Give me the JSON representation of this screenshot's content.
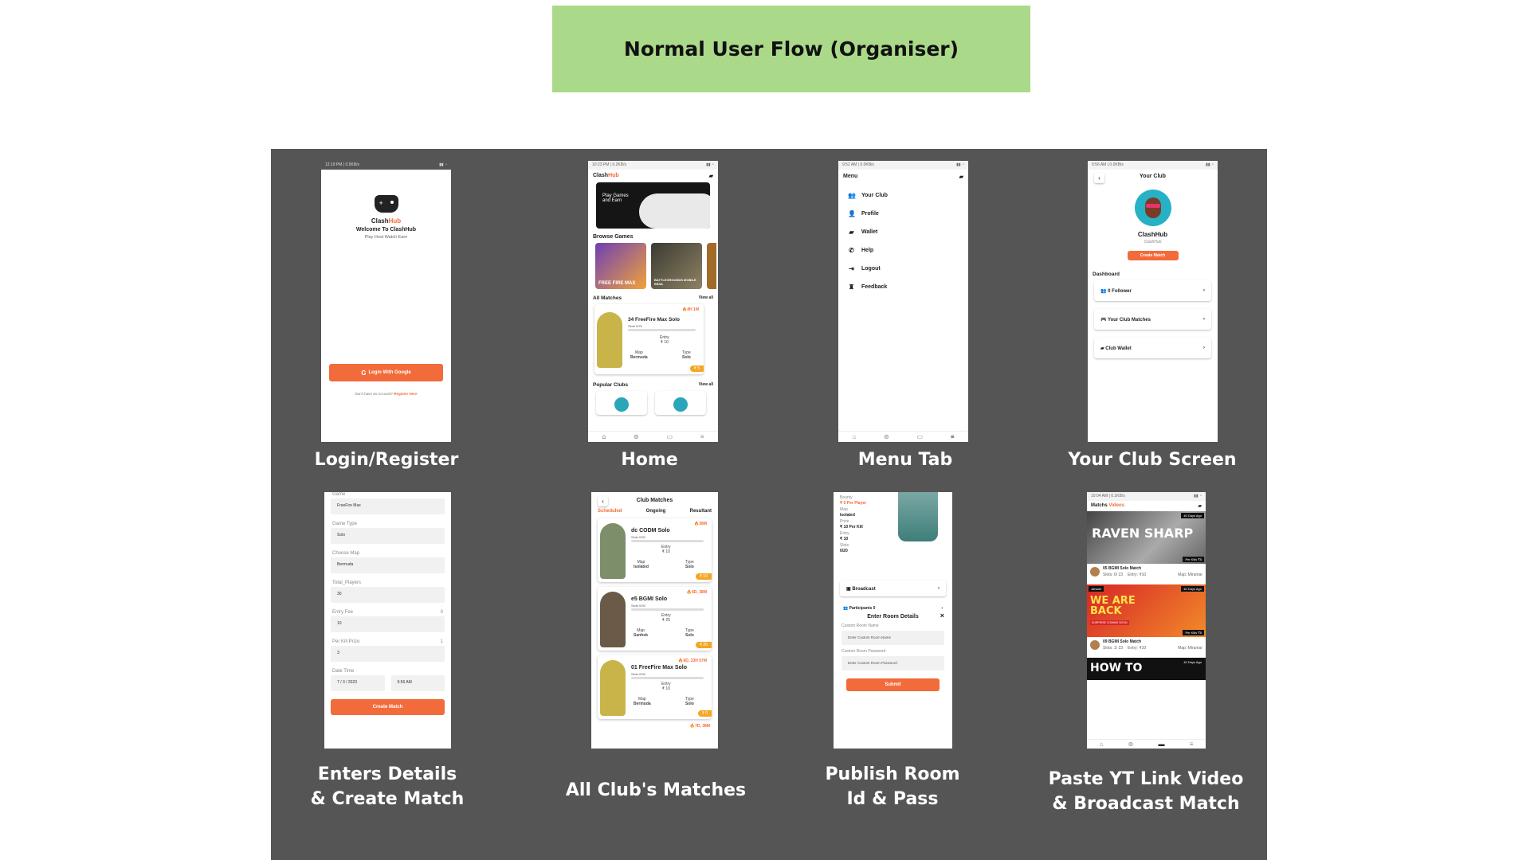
{
  "header": {
    "title": "Normal User Flow (Organiser)"
  },
  "screens": {
    "login": {
      "caption": "Login/Register",
      "status": "12:19 PM | 0.5KB/s",
      "brand_a": "Clash",
      "brand_b": "Hub",
      "welcome": "Welcome To ClashHub",
      "tagline": "Play Host Watch Earn",
      "google_btn": "Login With Google",
      "no_account": "Don't have an Account?",
      "register": "Register Here"
    },
    "home": {
      "caption": "Home",
      "status": "10:23 PM | 0.2KB/s",
      "brand_a": "Clash",
      "brand_b": "Hub",
      "banner": "Play Games and Earn",
      "browse": "Browse Games",
      "game1": "FREE FIRE MAX",
      "game2": "BATTLEGROUNDS MOBILE INDIA",
      "all_matches": "All Matches",
      "view_all": "View all",
      "hot": "4H 1M",
      "match_title": "34 FreeFire Max Solo",
      "slots": "Slots 0/20",
      "entry_lbl": "Entry",
      "entry": "₹ 10",
      "map_lbl": "Map",
      "map": "Bermuda",
      "type_lbl": "Type",
      "type": "Solo",
      "prize": "₹ 5",
      "popular": "Popular Clubs",
      "view_all2": "View all"
    },
    "menu": {
      "caption": "Menu Tab",
      "status": "9:52 AM | 0.0KB/s",
      "title": "Menu",
      "items": [
        {
          "label": "Your Club",
          "icon": "👥"
        },
        {
          "label": "Profile",
          "icon": "👤"
        },
        {
          "label": "Wallet",
          "icon": "▰"
        },
        {
          "label": "Help",
          "icon": "✆"
        },
        {
          "label": "Logout",
          "icon": "⇥"
        },
        {
          "label": "Feedback",
          "icon": "♜"
        }
      ]
    },
    "club": {
      "caption": "Your Club Screen",
      "status": "9:56 AM | 0.0KB/s",
      "title": "Your Club",
      "name": "ClashHub",
      "handle": "ClashHub",
      "create_btn": "Create Match",
      "dashboard": "Dashboard",
      "rows": [
        "0 Follower",
        "Your Club Matches",
        "Club Wallet"
      ]
    },
    "create": {
      "caption_1": "Enters Details",
      "caption_2": "& Create Match",
      "fields": [
        {
          "label": "Game",
          "value": "FreeFire Max"
        },
        {
          "label": "Game Type",
          "value": "Solo"
        },
        {
          "label": "Choose Map",
          "value": "Bermuda"
        },
        {
          "label": "Total_Players",
          "value": "30"
        },
        {
          "label": "Entry Fee",
          "value": "10"
        },
        {
          "label": "Per Kill Prize",
          "value": "3"
        }
      ],
      "entry_counter": "0",
      "kill_counter": "1",
      "date_lbl": "Date Time",
      "date": "7 / 3 / 2023",
      "time": "9:56 AM",
      "submit": "Create Match"
    },
    "club_matches": {
      "caption": "All Club's Matches",
      "title": "Club Matches",
      "tabs": [
        "Scheduled",
        "Ongoing",
        "Resultant"
      ],
      "cards": [
        {
          "title": "dc CODM Solo",
          "slots": "Slots 0/30",
          "hot": "38M",
          "entry": "₹ 10",
          "map": "Isolated",
          "type": "Solo",
          "prize": "₹ 10",
          "color": "#7d8f6a"
        },
        {
          "title": "e5 BGMI Solo",
          "slots": "Slots 0/30",
          "hot": "6D, 38M",
          "entry": "₹ 25",
          "map": "Sanhok",
          "type": "Solo",
          "prize": "₹ 20",
          "color": "#6b5a48"
        },
        {
          "title": "01 FreeFire Max Solo",
          "slots": "Slots 0/30",
          "hot": "6D, 23H 57M",
          "entry": "₹ 10",
          "map": "Bermuda",
          "type": "Solo",
          "prize": "₹ 0",
          "color": "#c9b44a"
        }
      ],
      "entry_lbl": "Entry",
      "map_lbl": "Map",
      "type_lbl": "Type",
      "next_hot": "7D, 38M"
    },
    "publish": {
      "caption_1": "Publish Room",
      "caption_2": "Id & Pass",
      "bounty_lbl": "Bounty",
      "bounty": "₹ 0 Per Player",
      "map_lbl": "Map",
      "map": "Isolated",
      "prize_lbl": "Prize",
      "prize": "₹ 10 Per Kill",
      "entry_lbl": "Entry",
      "entry": "₹ 10",
      "slots_lbl": "Slots",
      "slots": "0/20",
      "broadcast": "Broadcast",
      "participants": "Participants 0",
      "modal_title": "Enter Room Details",
      "room_name_lbl": "Custom Room Name",
      "room_name_ph": "Enter Custom Room Name",
      "room_pass_lbl": "Custom Room Password",
      "room_pass_ph": "Enter Custom Room Password",
      "submit": "Submit"
    },
    "yt": {
      "caption_1": "Paste YT Link Video",
      "caption_2": "& Broadcast Match",
      "status": "10:04 AM | 0.1KB/s",
      "tab_a": "Matchs",
      "tab_b": "Videos",
      "v1_tag": "40 Days Ago",
      "v1_text": "RAVEN SHARP",
      "v1_kills": "Per Kills ₹5",
      "v1_title": "05 BGMI Solo Match",
      "v1_slots": "Slots: 0/ 23",
      "v1_entry": "Entry: ₹10",
      "v1_map": "Map: Miramar",
      "v2_channel": "Jahwat",
      "v2_tag": "40 Days Ago",
      "v2_text": "WE ARE BACK",
      "v2_sub": "SURPRISE COMING SOON",
      "v2_kills": "Per Kills ₹5",
      "v2_title": "09 BGMI Solo Match",
      "v2_slots": "Slots: 1/ 23",
      "v2_entry": "Entry: ₹10",
      "v2_map": "Map: Miramar",
      "v3_text": "HOW TO",
      "v3_tag": "40 Days Ago"
    }
  }
}
